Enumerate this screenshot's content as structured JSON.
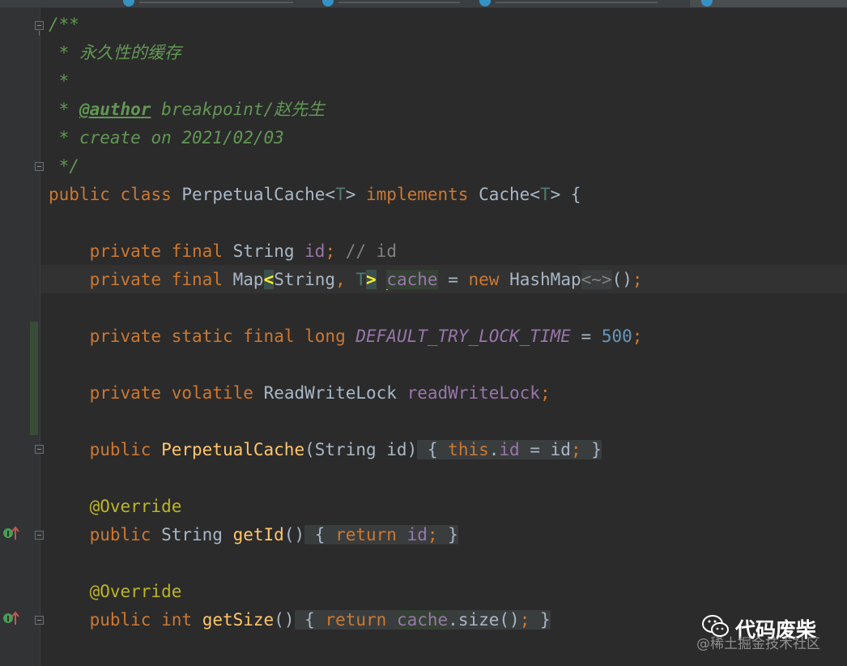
{
  "editor": {
    "lines": [
      {
        "text": "/**"
      },
      {
        "text": " * 永久性的缓存"
      },
      {
        "text": " *"
      },
      {
        "prefix": " * ",
        "tag": "@author",
        "rest": " breakpoint/赵先生"
      },
      {
        "text": " * create on 2021/02/03"
      },
      {
        "text": " */"
      },
      {
        "text": "public class PerpetualCache<T> implements Cache<T> {"
      },
      {
        "text": ""
      },
      {
        "text": "    private final String id; // id"
      },
      {
        "text": "    private final Map<String, T> cache = new HashMap<~>();"
      },
      {
        "text": ""
      },
      {
        "text": "    private static final long DEFAULT_TRY_LOCK_TIME = 500;"
      },
      {
        "text": ""
      },
      {
        "text": "    private volatile ReadWriteLock readWriteLock;"
      },
      {
        "text": ""
      },
      {
        "text": "    public PerpetualCache(String id) { this.id = id; }"
      },
      {
        "text": ""
      },
      {
        "text": "    @Override"
      },
      {
        "text": "    public String getId() { return id; }"
      },
      {
        "text": ""
      },
      {
        "text": "    @Override"
      },
      {
        "text": "    public int getSize() { return cache.size(); }"
      }
    ],
    "tokens": {
      "kw_public": "public",
      "kw_class": "class",
      "kw_private": "private",
      "kw_final": "final",
      "kw_static": "static",
      "kw_long": "long",
      "kw_volatile": "volatile",
      "kw_implements": "implements",
      "kw_new": "new",
      "kw_this": "this",
      "kw_return": "return",
      "kw_int": "int",
      "class_name": "PerpetualCache",
      "iface_name": "Cache",
      "type_param": "T",
      "type_string": "String",
      "type_map": "Map",
      "type_hashmap": "HashMap",
      "type_rwlock": "ReadWriteLock",
      "field_id": "id",
      "field_cache": "cache",
      "field_rwlock": "readWriteLock",
      "const_name": "DEFAULT_TRY_LOCK_TIME",
      "const_value": "500",
      "line_comment": "// id",
      "diamond": "<~>",
      "annotation": "@Override",
      "method_getid": "getId",
      "method_getsize": "getSize",
      "method_size": "size",
      "ctor_param": "id"
    },
    "comment_title": "永久性的缓存",
    "author_tag": "@author",
    "author_value": "breakpoint/赵先生",
    "create_text": "create on 2021/02/03"
  },
  "watermark": {
    "title": "代码废柴",
    "subtitle": "@稀土掘金技术社区"
  },
  "colors": {
    "background": "#2b2b2b",
    "keyword": "#cc7832",
    "comment": "#629755",
    "field": "#9876aa",
    "number": "#6897bb",
    "method_decl": "#ffc66d",
    "annotation": "#bbb529",
    "text": "#a9b7c6"
  }
}
